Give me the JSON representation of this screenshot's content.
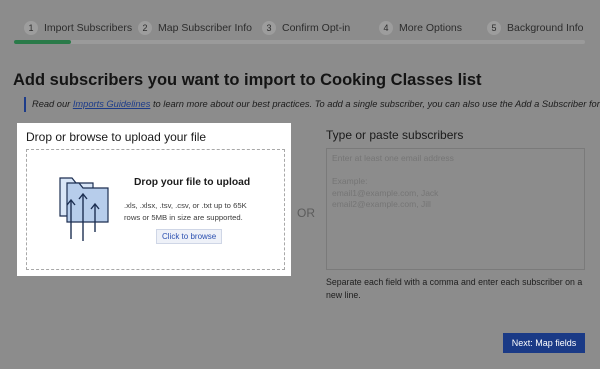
{
  "stepper": {
    "steps": [
      {
        "num": "1",
        "label": "Import Subscribers"
      },
      {
        "num": "2",
        "label": "Map Subscriber Info"
      },
      {
        "num": "3",
        "label": "Confirm Opt-in"
      },
      {
        "num": "4",
        "label": "More Options"
      },
      {
        "num": "5",
        "label": "Background Info"
      }
    ],
    "progress_fraction": 0.1
  },
  "page_title": "Add subscribers you want to import to Cooking Classes list",
  "info": {
    "prefix": "Read our ",
    "link": "Imports Guidelines",
    "suffix": " to learn more about our best practices. To add a single subscriber, you can also use the Add a Subscriber form"
  },
  "upload": {
    "heading": "Drop or browse to upload your file",
    "drop_title": "Drop your file to upload",
    "description": ".xls, .xlsx, .tsv, .csv, or .txt up to 65K rows or 5MB in size are supported.",
    "browse_label": "Click to browse",
    "icon": "folder-upload-icon"
  },
  "or_label": "OR",
  "paste": {
    "heading": "Type or paste subscribers",
    "placeholder": "Enter at least one email address\n\nExample:\nemail1@example.com, Jack\nemail2@example.com, Jill",
    "help": "Separate each field with a comma and enter each subscriber on a new line."
  },
  "next_label": "Next: Map fields",
  "colors": {
    "accent": "#1a3a86",
    "progress": "#2a7a49",
    "overlay": "#8c8c8c"
  }
}
